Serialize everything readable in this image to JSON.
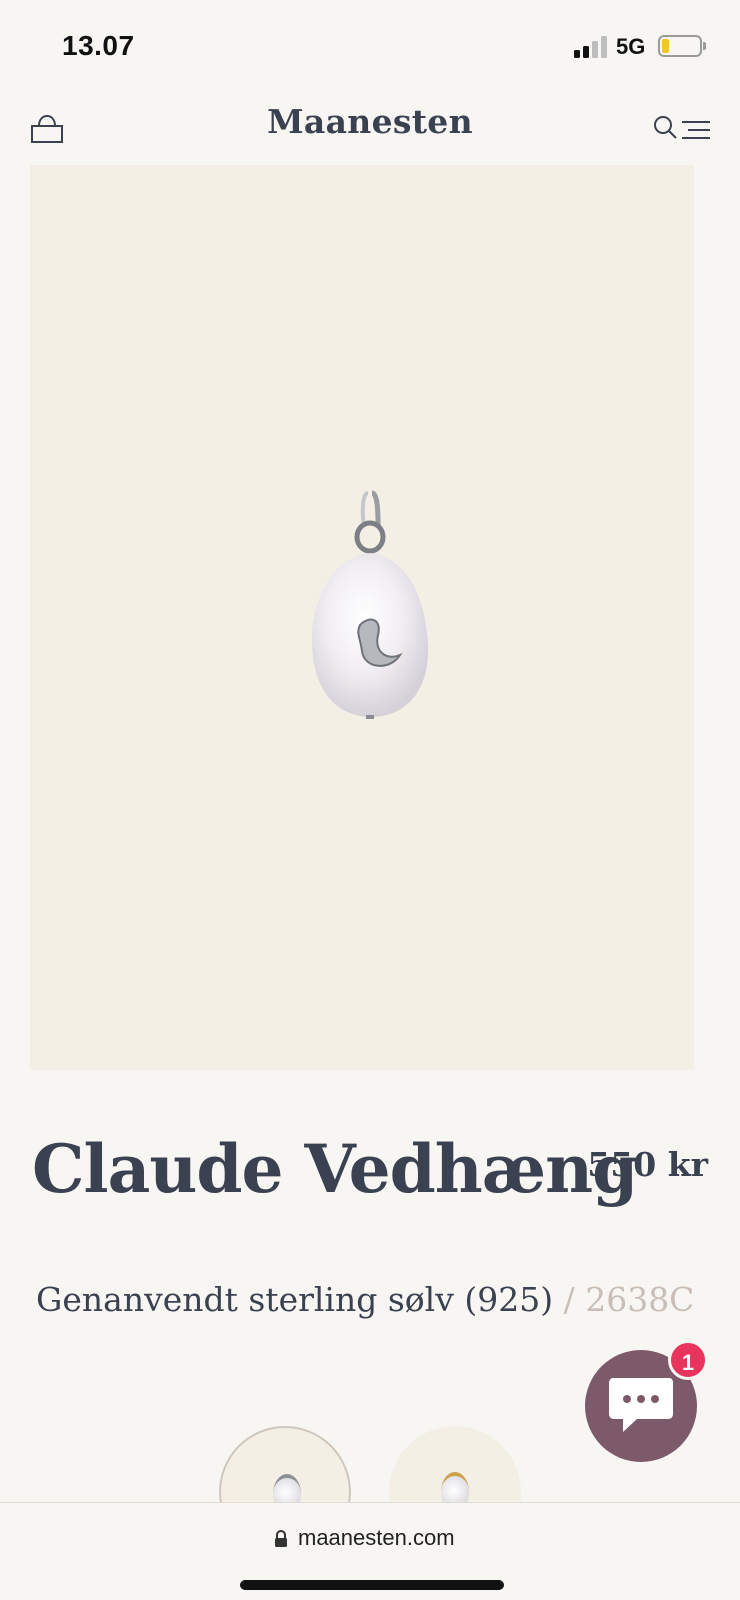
{
  "status_bar": {
    "time": "13.07",
    "network": "5G",
    "battery_color": "#f3c623"
  },
  "header": {
    "brand": "Maanesten",
    "icons": [
      "cart-icon",
      "search-icon",
      "menu-icon"
    ]
  },
  "product": {
    "title": "Claude Vedhæng",
    "price": "550 kr",
    "material": "Genanvendt sterling sølv (925)",
    "separator": "/",
    "code": "2638C",
    "image_background": "#f4efe5"
  },
  "variants": [
    {
      "name": "silver",
      "selected": true
    },
    {
      "name": "gold",
      "selected": false
    }
  ],
  "chat": {
    "badge": "1",
    "color": "#7d5a6a",
    "badge_color": "#e8345c"
  },
  "browser": {
    "url": "maanesten.com"
  }
}
